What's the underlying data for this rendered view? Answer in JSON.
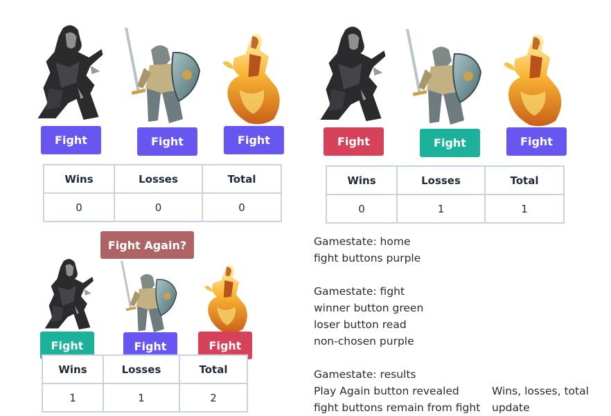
{
  "colors": {
    "purple": "#6757f0",
    "green": "#1bb19a",
    "red": "#d5425a",
    "again": "#ae6465",
    "border": "#c9d2de"
  },
  "characters": [
    "rogue-icon",
    "knight-icon",
    "fire-mage-icon"
  ],
  "panels": [
    {
      "buttons": [
        {
          "label": "Fight",
          "state": "purple"
        },
        {
          "label": "Fight",
          "state": "purple"
        },
        {
          "label": "Fight",
          "state": "purple"
        }
      ],
      "table": {
        "headers": [
          "Wins",
          "Losses",
          "Total"
        ],
        "values": [
          "0",
          "0",
          "0"
        ]
      }
    },
    {
      "buttons": [
        {
          "label": "Fight",
          "state": "red"
        },
        {
          "label": "Fight",
          "state": "green"
        },
        {
          "label": "Fight",
          "state": "purple"
        }
      ],
      "table": {
        "headers": [
          "Wins",
          "Losses",
          "Total"
        ],
        "values": [
          "0",
          "1",
          "1"
        ]
      }
    },
    {
      "fight_again_label": "Fight Again?",
      "buttons": [
        {
          "label": "Fight",
          "state": "green"
        },
        {
          "label": "Fight",
          "state": "purple"
        },
        {
          "label": "Fight",
          "state": "red"
        }
      ],
      "table": {
        "headers": [
          "Wins",
          "Losses",
          "Total"
        ],
        "values": [
          "1",
          "1",
          "2"
        ]
      }
    }
  ],
  "notes": {
    "lines": [
      "Gamestate: home",
      "fight buttons purple",
      "",
      "Gamestate: fight",
      "winner button green",
      "loser button read",
      "non-chosen purple",
      "",
      "Gamestate: results",
      "Play Again button revealed",
      "fight buttons remain from fight"
    ],
    "side_lines": [
      "Wins, losses, total",
      "update"
    ]
  }
}
